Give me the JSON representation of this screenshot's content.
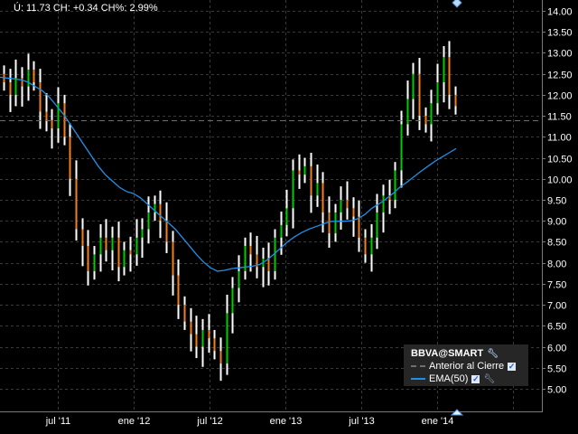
{
  "header": {
    "text": "Ú: 11.73 CH: +0.34 CH%: 2.99%"
  },
  "legend": {
    "title": "BBVA@SMART",
    "items": [
      {
        "label": "Anterior al Cierre",
        "color": "#6e6e6e",
        "style": "dashed"
      },
      {
        "label": "EMA(50)",
        "color": "#1e90e8",
        "style": "solid"
      }
    ]
  },
  "colors": {
    "background": "#000000",
    "up": "#00cc00",
    "down": "#f08020",
    "wick": "#ffffff",
    "grid": "#3a3a3a",
    "axis": "#7a7a7a"
  },
  "chart_data": {
    "type": "ohlc",
    "title": "BBVA@SMART",
    "ylim": [
      4.5,
      14.25
    ],
    "y_ticks": [
      "14.00",
      "13.50",
      "13.00",
      "12.50",
      "12.00",
      "11.50",
      "11.00",
      "10.50",
      "10.00",
      "9.50",
      "9.00",
      "8.50",
      "8.00",
      "7.50",
      "7.00",
      "6.50",
      "6.00",
      "5.50",
      "5.00"
    ],
    "x_ticks": [
      "jul '11",
      "ene '12",
      "jul '12",
      "ene '13",
      "jul '13",
      "ene '14"
    ],
    "previous_close": 11.39,
    "open_first": 12.5,
    "close": [
      12.3,
      12.0,
      12.4,
      12.2,
      12.6,
      12.3,
      11.6,
      11.4,
      11.2,
      11.8,
      11.0,
      10.0,
      8.8,
      8.4,
      7.8,
      8.2,
      8.6,
      8.3,
      8.6,
      7.9,
      8.3,
      8.2,
      8.6,
      8.8,
      9.2,
      9.4,
      9.0,
      8.5,
      7.7,
      7.0,
      6.6,
      6.3,
      6.0,
      6.4,
      6.2,
      5.9,
      5.6,
      6.8,
      7.4,
      7.8,
      8.4,
      8.2,
      7.9,
      8.1,
      7.8,
      8.6,
      8.9,
      9.3,
      10.2,
      10.1,
      10.3,
      9.6,
      9.9,
      9.2,
      8.7,
      9.2,
      9.5,
      9.3,
      9.1,
      8.6,
      8.2,
      8.6,
      9.2,
      9.6,
      9.5,
      10.2,
      11.3,
      11.9,
      12.5,
      11.5,
      11.3,
      11.8,
      12.3,
      12.9,
      12.0,
      11.73
    ],
    "ema50": [
      12.42,
      12.4,
      12.38,
      12.36,
      12.3,
      12.2,
      12.1,
      11.95,
      11.75,
      11.55,
      11.3,
      11.05,
      10.8,
      10.55,
      10.3,
      10.1,
      9.95,
      9.8,
      9.7,
      9.65,
      9.55,
      9.4,
      9.25,
      9.1,
      8.95,
      8.8,
      8.6,
      8.4,
      8.2,
      8.02,
      7.88,
      7.8,
      7.82,
      7.86,
      7.88,
      7.9,
      7.92,
      7.96,
      8.06,
      8.2,
      8.35,
      8.5,
      8.62,
      8.72,
      8.8,
      8.86,
      8.92,
      8.98,
      8.99,
      8.99,
      9.0,
      9.05,
      9.15,
      9.3,
      9.4,
      9.52,
      9.65,
      9.8,
      9.92,
      10.05,
      10.18,
      10.3,
      10.42,
      10.52,
      10.62,
      10.72
    ]
  }
}
